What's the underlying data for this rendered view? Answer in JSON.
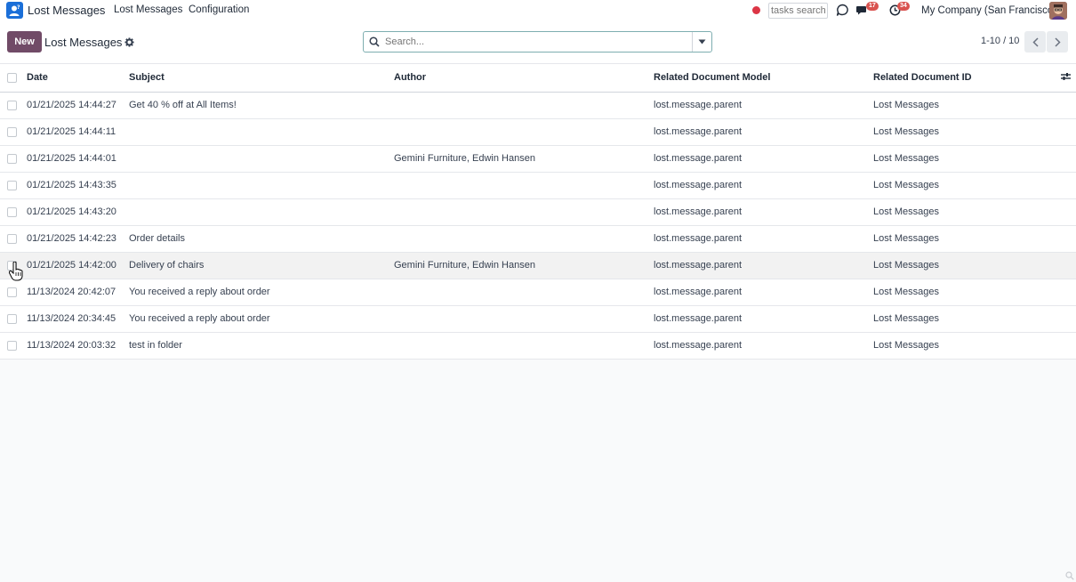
{
  "navbar": {
    "app_name": "Lost Messages",
    "menu": [
      "Lost Messages",
      "Configuration"
    ],
    "tasks_search_placeholder": "tasks search",
    "messages_badge": "17",
    "activities_badge": "34",
    "company": "My Company (San Francisco)"
  },
  "control": {
    "new_label": "New",
    "title": "Lost Messages",
    "search_placeholder": "Search...",
    "pager": "1-10 / 10"
  },
  "table": {
    "headers": [
      "Date",
      "Subject",
      "Author",
      "Related Document Model",
      "Related Document ID"
    ],
    "rows": [
      {
        "date": "01/21/2025 14:44:27",
        "subject": "Get 40 % off at All Items!",
        "author": "",
        "model": "lost.message.parent",
        "doc_id": "Lost Messages"
      },
      {
        "date": "01/21/2025 14:44:11",
        "subject": "",
        "author": "",
        "model": "lost.message.parent",
        "doc_id": "Lost Messages"
      },
      {
        "date": "01/21/2025 14:44:01",
        "subject": "",
        "author": "Gemini Furniture, Edwin Hansen",
        "model": "lost.message.parent",
        "doc_id": "Lost Messages"
      },
      {
        "date": "01/21/2025 14:43:35",
        "subject": "",
        "author": "",
        "model": "lost.message.parent",
        "doc_id": "Lost Messages"
      },
      {
        "date": "01/21/2025 14:43:20",
        "subject": "",
        "author": "",
        "model": "lost.message.parent",
        "doc_id": "Lost Messages"
      },
      {
        "date": "01/21/2025 14:42:23",
        "subject": "Order details",
        "author": "",
        "model": "lost.message.parent",
        "doc_id": "Lost Messages"
      },
      {
        "date": "01/21/2025 14:42:00",
        "subject": "Delivery of chairs",
        "author": "Gemini Furniture, Edwin Hansen",
        "model": "lost.message.parent",
        "doc_id": "Lost Messages"
      },
      {
        "date": "11/13/2024 20:42:07",
        "subject": "You received a reply about order",
        "author": "",
        "model": "lost.message.parent",
        "doc_id": "Lost Messages"
      },
      {
        "date": "11/13/2024 20:34:45",
        "subject": "You received a reply about order",
        "author": "",
        "model": "lost.message.parent",
        "doc_id": "Lost Messages"
      },
      {
        "date": "11/13/2024 20:03:32",
        "subject": "test in folder",
        "author": "",
        "model": "lost.message.parent",
        "doc_id": "Lost Messages"
      }
    ]
  },
  "colors": {
    "brand": "#714b67",
    "app_icon": "#1b6fd8",
    "badge": "#d9534f",
    "record_dot": "#dc3545"
  }
}
